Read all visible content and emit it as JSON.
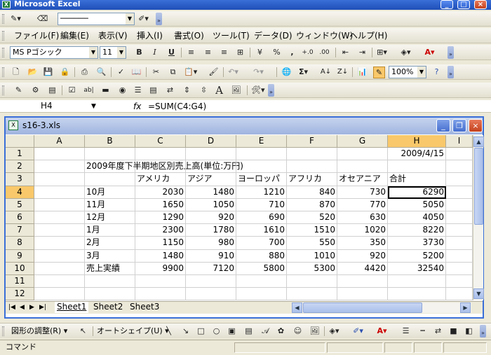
{
  "app": {
    "title": "Microsoft Excel"
  },
  "menu": [
    "ファイル(F)",
    "編集(E)",
    "表示(V)",
    "挿入(I)",
    "書式(O)",
    "ツール(T)",
    "データ(D)",
    "ウィンドウ(W)",
    "ヘルプ(H)"
  ],
  "format_toolbar": {
    "font": "MS Pゴシック",
    "size": "11",
    "bold": "B",
    "italic": "I",
    "underline": "U",
    "percent": "%",
    "comma": ","
  },
  "standard_toolbar": {
    "zoom": "100%",
    "sigma": "Σ"
  },
  "forms_toolbar": {
    "label_a": "A"
  },
  "formula_bar": {
    "cell_ref": "H4",
    "fx": "fx",
    "formula": "=SUM(C4:G4)"
  },
  "workbook": {
    "title": "s16-3.xls"
  },
  "columns": [
    "A",
    "B",
    "C",
    "D",
    "E",
    "F",
    "G",
    "H",
    "I"
  ],
  "rows": [
    {
      "n": "1",
      "B": "",
      "C": "",
      "D": "",
      "E": "",
      "F": "",
      "G": "",
      "H": "2009/4/15"
    },
    {
      "n": "2",
      "B": "2009年度下半期地区別売上高(単位:万円)",
      "C": "",
      "D": "",
      "E": "",
      "F": "",
      "G": "",
      "H": ""
    },
    {
      "n": "3",
      "B": "",
      "C": "アメリカ",
      "D": "アジア",
      "E": "ヨーロッパ",
      "F": "アフリカ",
      "G": "オセアニア",
      "H": "合計"
    },
    {
      "n": "4",
      "B": "10月",
      "C": "2030",
      "D": "1480",
      "E": "1210",
      "F": "840",
      "G": "730",
      "H": "6290"
    },
    {
      "n": "5",
      "B": "11月",
      "C": "1650",
      "D": "1050",
      "E": "710",
      "F": "870",
      "G": "770",
      "H": "5050"
    },
    {
      "n": "6",
      "B": "12月",
      "C": "1290",
      "D": "920",
      "E": "690",
      "F": "520",
      "G": "630",
      "H": "4050"
    },
    {
      "n": "7",
      "B": "1月",
      "C": "2300",
      "D": "1780",
      "E": "1610",
      "F": "1510",
      "G": "1020",
      "H": "8220"
    },
    {
      "n": "8",
      "B": "2月",
      "C": "1150",
      "D": "980",
      "E": "700",
      "F": "550",
      "G": "350",
      "H": "3730"
    },
    {
      "n": "9",
      "B": "3月",
      "C": "1480",
      "D": "910",
      "E": "880",
      "F": "1010",
      "G": "920",
      "H": "5200"
    },
    {
      "n": "10",
      "B": "売上実績",
      "C": "9900",
      "D": "7120",
      "E": "5800",
      "F": "5300",
      "G": "4420",
      "H": "32540"
    },
    {
      "n": "11",
      "B": "",
      "C": "",
      "D": "",
      "E": "",
      "F": "",
      "G": "",
      "H": ""
    },
    {
      "n": "12",
      "B": "",
      "C": "",
      "D": "",
      "E": "",
      "F": "",
      "G": "",
      "H": ""
    }
  ],
  "sheets": [
    "Sheet1",
    "Sheet2",
    "Sheet3"
  ],
  "draw_toolbar": {
    "adjust": "図形の調整(R)",
    "autoshape": "オートシェイプ(U)",
    "label_a": "A"
  },
  "status": {
    "mode": "コマンド"
  }
}
